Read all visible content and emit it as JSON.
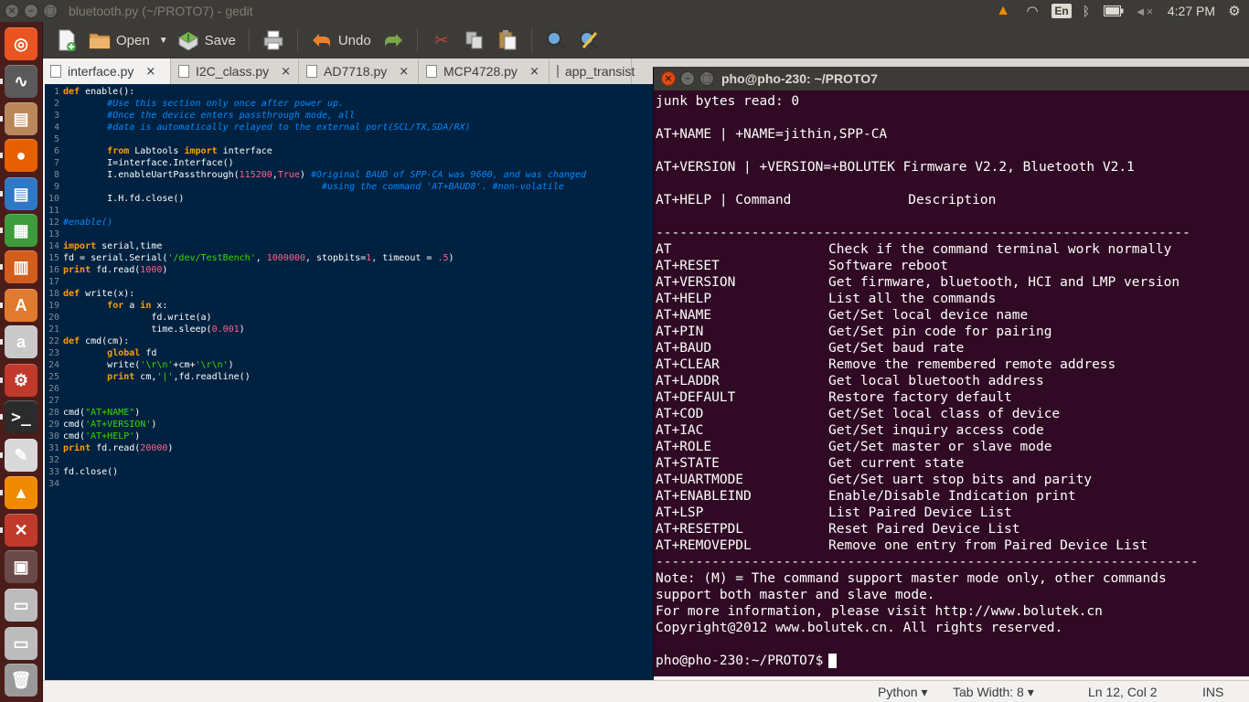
{
  "top_panel": {
    "app_title": "bluetooth.py (~/PROTO7) - gedit",
    "keyboard_layout": "En",
    "clock": "4:27 PM"
  },
  "launcher": {
    "items": [
      {
        "name": "ubuntu-dash-icon",
        "glyph": "◎",
        "color": "#e95420"
      },
      {
        "name": "system-monitor-icon",
        "glyph": "∿",
        "color": "#5a5a5a"
      },
      {
        "name": "files-icon",
        "glyph": "▤",
        "color": "#b9875a"
      },
      {
        "name": "firefox-icon",
        "glyph": "●",
        "color": "#e66000"
      },
      {
        "name": "writer-icon",
        "glyph": "▤",
        "color": "#2f78c6"
      },
      {
        "name": "calc-icon",
        "glyph": "▦",
        "color": "#3d9b3b"
      },
      {
        "name": "impress-icon",
        "glyph": "▥",
        "color": "#d35d1c"
      },
      {
        "name": "software-center-icon",
        "glyph": "A",
        "color": "#e07a2f"
      },
      {
        "name": "amazon-icon",
        "glyph": "a",
        "color": "#c9c9c9"
      },
      {
        "name": "settings-icon",
        "glyph": "⚙",
        "color": "#c0392b"
      },
      {
        "name": "terminal-icon",
        "glyph": ">_",
        "color": "#2b2b2b"
      },
      {
        "name": "text-editor-icon",
        "glyph": "✎",
        "color": "#d9d9d9"
      },
      {
        "name": "vlc-icon",
        "glyph": "▲",
        "color": "#f08a00"
      },
      {
        "name": "expeyes-icon",
        "glyph": "✕",
        "color": "#c0392b"
      },
      {
        "name": "workspace-switcher-icon",
        "glyph": "▣",
        "color": "#6a4a48"
      },
      {
        "name": "drive-1-icon",
        "glyph": "▭",
        "color": "#bcbcbc"
      },
      {
        "name": "drive-2-icon",
        "glyph": "▭",
        "color": "#bcbcbc"
      },
      {
        "name": "trash-icon",
        "glyph": "🗑",
        "color": "#9a9a9a"
      }
    ]
  },
  "toolbar": {
    "open_label": "Open",
    "save_label": "Save",
    "undo_label": "Undo"
  },
  "tabs": [
    {
      "label": "interface.py",
      "close": "×"
    },
    {
      "label": "I2C_class.py",
      "close": "×"
    },
    {
      "label": "AD7718.py",
      "close": "×"
    },
    {
      "label": "MCP4728.py",
      "close": "×"
    },
    {
      "label": "app_transist",
      "close": ""
    }
  ],
  "code": [
    [
      {
        "c": "c-kw",
        "t": "def"
      },
      {
        "c": "c-tx",
        "t": " enable():"
      }
    ],
    [
      {
        "c": "c-tx",
        "t": "        "
      },
      {
        "c": "c-cm",
        "t": "#Use this section only once after power up."
      }
    ],
    [
      {
        "c": "c-tx",
        "t": "        "
      },
      {
        "c": "c-cm",
        "t": "#Once the device enters passthrough mode, all"
      }
    ],
    [
      {
        "c": "c-tx",
        "t": "        "
      },
      {
        "c": "c-cm",
        "t": "#data is automatically relayed to the external port(SCL/TX,SDA/RX)"
      }
    ],
    [],
    [
      {
        "c": "c-tx",
        "t": "        "
      },
      {
        "c": "c-kw",
        "t": "from"
      },
      {
        "c": "c-tx",
        "t": " Labtools "
      },
      {
        "c": "c-kw",
        "t": "import"
      },
      {
        "c": "c-tx",
        "t": " interface"
      }
    ],
    [
      {
        "c": "c-tx",
        "t": "        I=interface.Interface()"
      }
    ],
    [
      {
        "c": "c-tx",
        "t": "        I.enableUartPassthrough("
      },
      {
        "c": "c-nu",
        "t": "115200"
      },
      {
        "c": "c-tx",
        "t": ","
      },
      {
        "c": "c-nu",
        "t": "True"
      },
      {
        "c": "c-tx",
        "t": ") "
      },
      {
        "c": "c-cm",
        "t": "#Original BAUD of SPP-CA was 9600, and was changed"
      }
    ],
    [
      {
        "c": "c-tx",
        "t": "                                               "
      },
      {
        "c": "c-cm",
        "t": "#using the command 'AT+BAUD8'. #non-volatile"
      }
    ],
    [
      {
        "c": "c-tx",
        "t": "        I.H.fd.close()"
      }
    ],
    [],
    [
      {
        "c": "c-cm",
        "t": "#enable()"
      }
    ],
    [],
    [
      {
        "c": "c-kw",
        "t": "import"
      },
      {
        "c": "c-tx",
        "t": " serial,time"
      }
    ],
    [
      {
        "c": "c-tx",
        "t": "fd = serial.Serial("
      },
      {
        "c": "c-st",
        "t": "'/dev/TestBench'"
      },
      {
        "c": "c-tx",
        "t": ", "
      },
      {
        "c": "c-nu",
        "t": "1000000"
      },
      {
        "c": "c-tx",
        "t": ", stopbits="
      },
      {
        "c": "c-nu",
        "t": "1"
      },
      {
        "c": "c-tx",
        "t": ", timeout = "
      },
      {
        "c": "c-nu",
        "t": ".5"
      },
      {
        "c": "c-tx",
        "t": ")"
      }
    ],
    [
      {
        "c": "c-kw",
        "t": "print"
      },
      {
        "c": "c-tx",
        "t": " fd.read("
      },
      {
        "c": "c-nu",
        "t": "1000"
      },
      {
        "c": "c-tx",
        "t": ")"
      }
    ],
    [],
    [
      {
        "c": "c-kw",
        "t": "def"
      },
      {
        "c": "c-tx",
        "t": " write(x):"
      }
    ],
    [
      {
        "c": "c-tx",
        "t": "        "
      },
      {
        "c": "c-kw",
        "t": "for"
      },
      {
        "c": "c-tx",
        "t": " a "
      },
      {
        "c": "c-kw",
        "t": "in"
      },
      {
        "c": "c-tx",
        "t": " x:"
      }
    ],
    [
      {
        "c": "c-tx",
        "t": "                fd.write(a)"
      }
    ],
    [
      {
        "c": "c-tx",
        "t": "                time.sleep("
      },
      {
        "c": "c-nu",
        "t": "0.001"
      },
      {
        "c": "c-tx",
        "t": ")"
      }
    ],
    [
      {
        "c": "c-kw",
        "t": "def"
      },
      {
        "c": "c-tx",
        "t": " cmd(cm):"
      }
    ],
    [
      {
        "c": "c-tx",
        "t": "        "
      },
      {
        "c": "c-kw",
        "t": "global"
      },
      {
        "c": "c-tx",
        "t": " fd"
      }
    ],
    [
      {
        "c": "c-tx",
        "t": "        write("
      },
      {
        "c": "c-st",
        "t": "'\\r\\n'"
      },
      {
        "c": "c-tx",
        "t": "+cm+"
      },
      {
        "c": "c-st",
        "t": "'\\r\\n'"
      },
      {
        "c": "c-tx",
        "t": ")"
      }
    ],
    [
      {
        "c": "c-tx",
        "t": "        "
      },
      {
        "c": "c-kw",
        "t": "print"
      },
      {
        "c": "c-tx",
        "t": " cm,"
      },
      {
        "c": "c-st",
        "t": "'|'"
      },
      {
        "c": "c-tx",
        "t": ",fd.readline()"
      }
    ],
    [],
    [],
    [
      {
        "c": "c-tx",
        "t": "cmd("
      },
      {
        "c": "c-st",
        "t": "\"AT+NAME\""
      },
      {
        "c": "c-tx",
        "t": ")"
      }
    ],
    [
      {
        "c": "c-tx",
        "t": "cmd("
      },
      {
        "c": "c-st",
        "t": "'AT+VERSION'"
      },
      {
        "c": "c-tx",
        "t": ")"
      }
    ],
    [
      {
        "c": "c-tx",
        "t": "cmd("
      },
      {
        "c": "c-st",
        "t": "'AT+HELP'"
      },
      {
        "c": "c-tx",
        "t": ")"
      }
    ],
    [
      {
        "c": "c-kw",
        "t": "print"
      },
      {
        "c": "c-tx",
        "t": " fd.read("
      },
      {
        "c": "c-nu",
        "t": "20000"
      },
      {
        "c": "c-tx",
        "t": ")"
      }
    ],
    [],
    [
      {
        "c": "c-tx",
        "t": "fd.close()"
      }
    ],
    []
  ],
  "terminal": {
    "title": "pho@pho-230: ~/PROTO7",
    "lines": [
      [
        "junk bytes read: 0"
      ],
      [
        ""
      ],
      [
        "AT+NAME | +NAME=jithin,SPP-CA"
      ],
      [
        ""
      ],
      [
        "AT+VERSION | +VERSION=+BOLUTEK Firmware V2.2, Bluetooth V2.1"
      ],
      [
        ""
      ],
      [
        "AT+HELP | Command",
        "          Description"
      ],
      [
        ""
      ],
      [
        "-------------------------------------------------------------------"
      ],
      [
        "AT",
        "Check if the command terminal work normally"
      ],
      [
        "AT+RESET",
        "Software reboot"
      ],
      [
        "AT+VERSION",
        "Get firmware, bluetooth, HCI and LMP version"
      ],
      [
        "AT+HELP",
        "List all the commands"
      ],
      [
        "AT+NAME",
        "Get/Set local device name"
      ],
      [
        "AT+PIN",
        "Get/Set pin code for pairing"
      ],
      [
        "AT+BAUD",
        "Get/Set baud rate"
      ],
      [
        "AT+CLEAR",
        "Remove the remembered remote address"
      ],
      [
        "AT+LADDR",
        "Get local bluetooth address"
      ],
      [
        "AT+DEFAULT",
        "Restore factory default"
      ],
      [
        "AT+COD",
        "Get/Set local class of device"
      ],
      [
        "AT+IAC",
        "Get/Set inquiry access code"
      ],
      [
        "AT+ROLE",
        "Get/Set master or slave mode"
      ],
      [
        "AT+STATE",
        "Get current state"
      ],
      [
        "AT+UARTMODE",
        "Get/Set uart stop bits and parity"
      ],
      [
        "AT+ENABLEIND",
        "Enable/Disable Indication print"
      ],
      [
        "AT+LSP",
        "List Paired Device List"
      ],
      [
        "AT+RESETPDL",
        "Reset Paired Device List"
      ],
      [
        "AT+REMOVEPDL",
        "Remove one entry from Paired Device List"
      ],
      [
        "--------------------------------------------------------------------"
      ],
      [
        "Note: (M) = The command support master mode only, other commands"
      ],
      [
        "support both master and slave mode."
      ],
      [
        "For more information, please visit http://www.bolutek.cn"
      ],
      [
        "Copyright@2012 www.bolutek.cn. All rights reserved."
      ],
      [
        ""
      ],
      [
        "pho@pho-230:~/PROTO7$"
      ]
    ]
  },
  "status": {
    "language": "Python ▾",
    "tab_width": "Tab Width: 8 ▾",
    "position": "Ln 12, Col 2",
    "mode": "INS"
  }
}
